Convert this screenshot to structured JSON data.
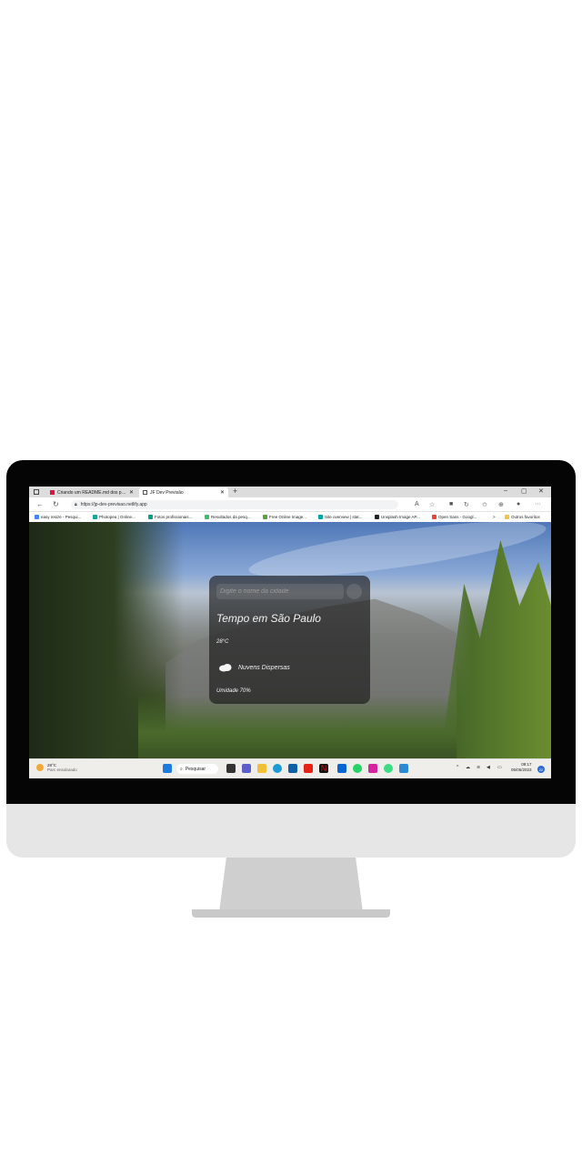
{
  "browser": {
    "tabs": [
      {
        "label": "Criando um README.md dos pr...",
        "active": false
      },
      {
        "label": "JF Dev Previsão",
        "active": true
      }
    ],
    "new_tab_label": "+",
    "window_controls": {
      "minimize": "–",
      "maximize": "▢",
      "close": "✕"
    },
    "address": "https://jp-dev-previsao.netlify.app",
    "favorites": [
      {
        "label": "easy resize - Pesqui...",
        "color": "#4285f4"
      },
      {
        "label": "Photopea | Online...",
        "color": "#18a497"
      },
      {
        "label": "Fotos profissionais...",
        "color": "#05a081"
      },
      {
        "label": "Resultados da pesq...",
        "color": "#3cbf6a"
      },
      {
        "label": "Free Online Image...",
        "color": "#5aa53a"
      },
      {
        "label": "Site overview | stat...",
        "color": "#00a6a6"
      },
      {
        "label": "Unsplash Image AP...",
        "color": "#222222"
      },
      {
        "label": "Open Sans - Googl...",
        "color": "#ea4335"
      }
    ],
    "favorites_overflow": ">",
    "other_favorites": "Outros favoritos"
  },
  "weather_app": {
    "search_placeholder": "Digite o nome da cidade",
    "city_title": "Tempo em São Paulo",
    "temperature": "28°C",
    "condition": "Nuvens Dispersas",
    "humidity": "Umidade 70%"
  },
  "taskbar": {
    "weather_temp": "28°C",
    "weather_desc": "Parc ensolarado",
    "search_label": "Pesquisar",
    "time": "09:17",
    "date": "05/05/2023",
    "notification_count": "22",
    "pinned_icons": [
      "start-icon",
      "task-view-icon",
      "teams-icon",
      "file-explorer-icon",
      "edge-icon",
      "store-icon",
      "youtube-icon",
      "netflix-icon",
      "mail-icon",
      "whatsapp-icon",
      "instagram-icon",
      "android-studio-icon",
      "vscode-icon"
    ]
  },
  "colors": {
    "card_bg": "rgba(20,20,20,0.62)",
    "accent": "#2b6ad8"
  }
}
